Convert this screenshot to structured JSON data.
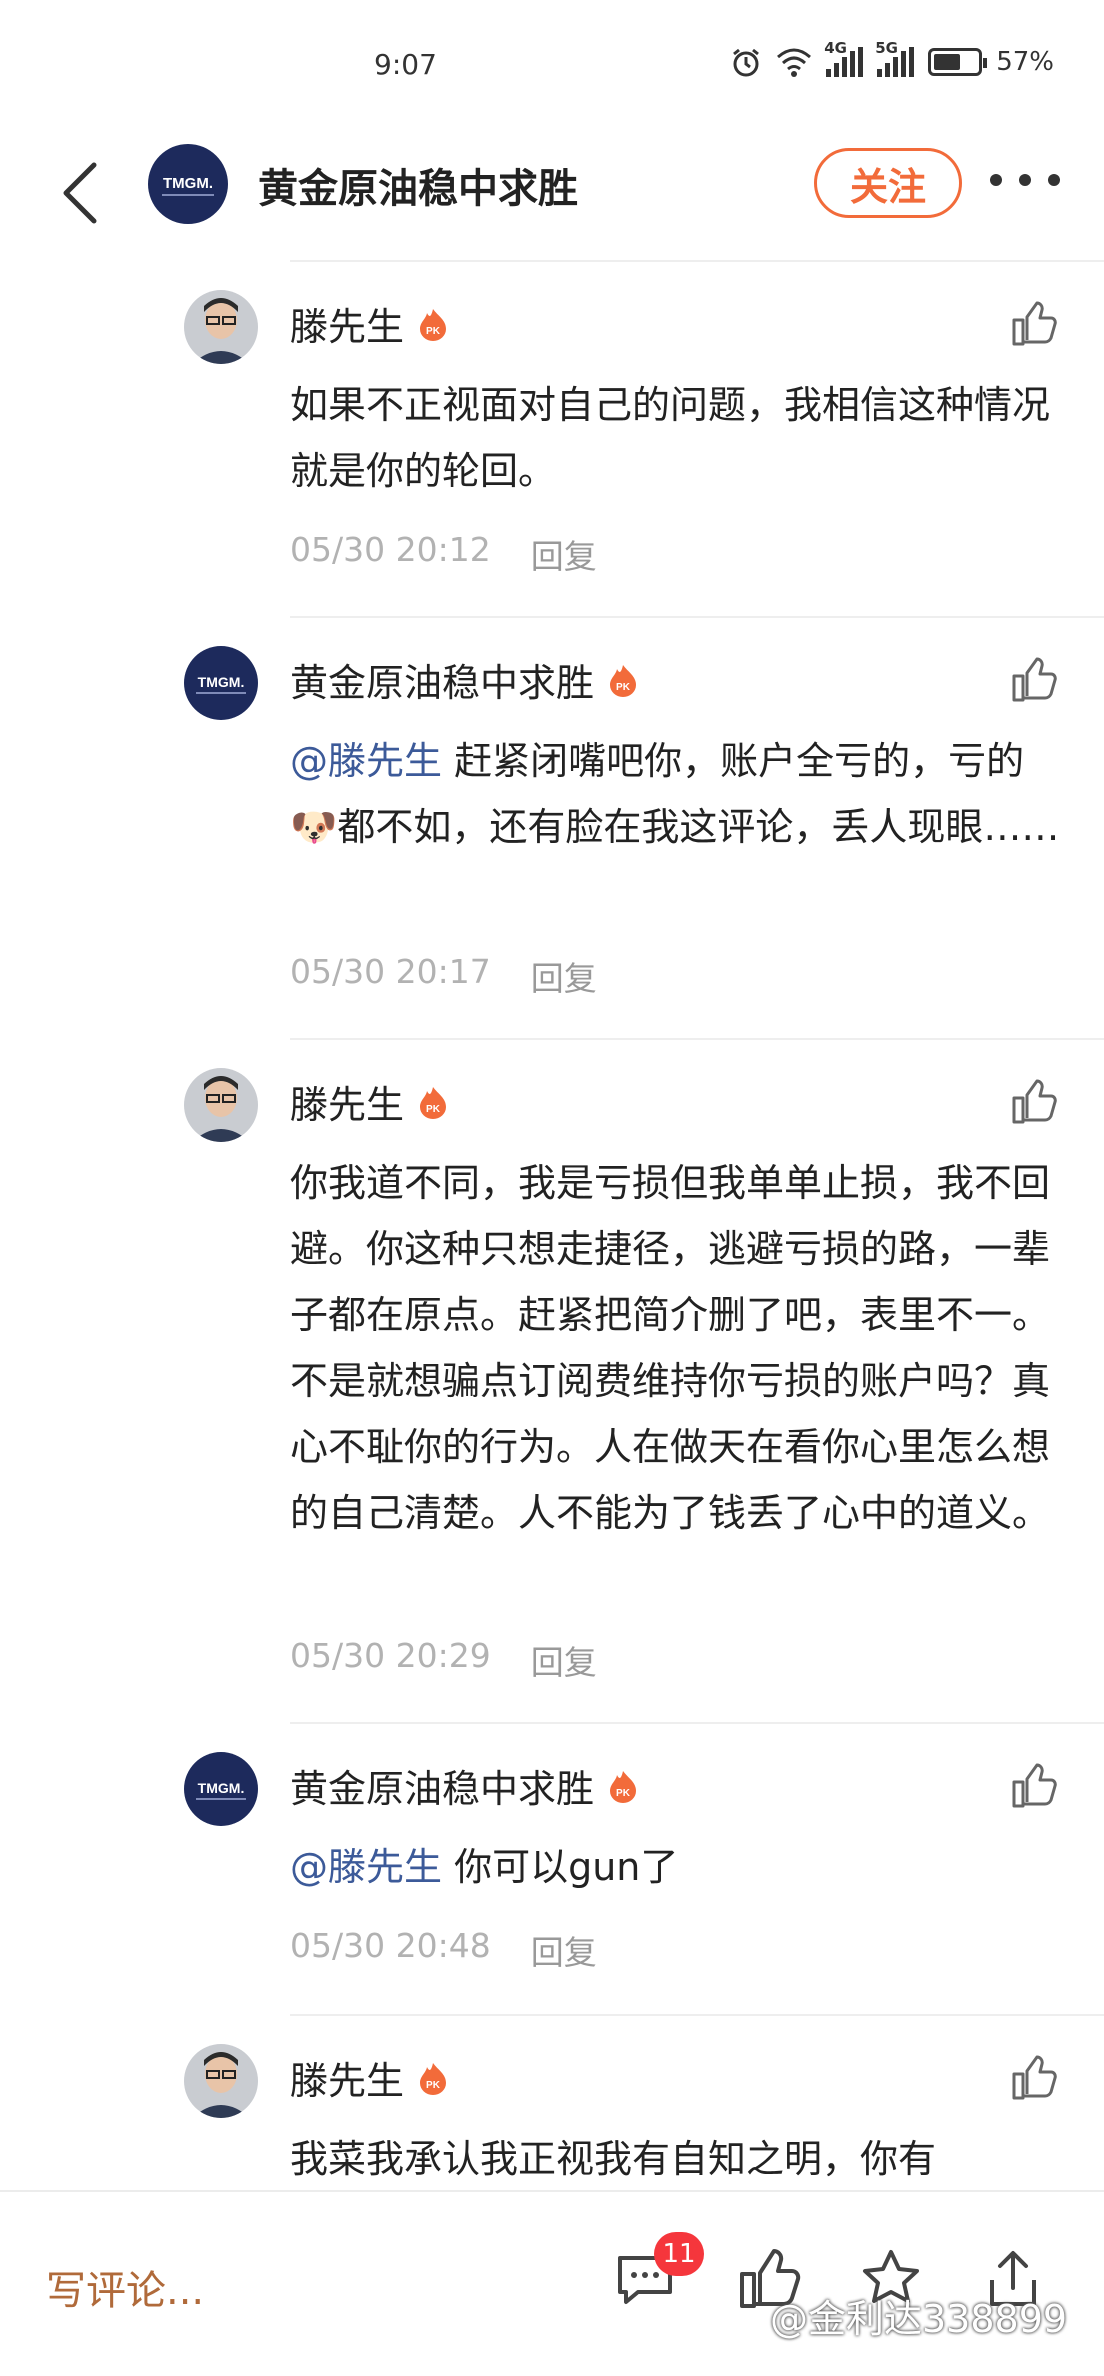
{
  "status_bar": {
    "time": "9:07",
    "network_4g": "4G",
    "network_5g": "5G",
    "battery": "57%"
  },
  "header": {
    "title": "黄金原油稳中求胜",
    "follow_label": "关注",
    "logo_text": "TMGM."
  },
  "comments": [
    {
      "user": "滕先生",
      "text": "如果不正视面对自己的问题，我相信这种情况就是你的轮回。",
      "mention": "",
      "time": "05/30 20:12",
      "reply": "回复"
    },
    {
      "user": "黄金原油稳中求胜",
      "mention": "@滕先生",
      "text": " 赶紧闭嘴吧你，账户全亏的，亏的🐶都不如，还有脸在我这评论，丢人现眼……",
      "time": "05/30 20:17",
      "reply": "回复"
    },
    {
      "user": "滕先生",
      "text": "你我道不同，我是亏损但我单单止损，我不回避。你这种只想走捷径，逃避亏损的路，一辈子都在原点。赶紧把简介删了吧，表里不一。不是就想骗点订阅费维持你亏损的账户吗？真心不耻你的行为。人在做天在看你心里怎么想的自己清楚。人不能为了钱丢了心中的道义。",
      "mention": "",
      "time": "05/30 20:29",
      "reply": "回复"
    },
    {
      "user": "黄金原油稳中求胜",
      "mention": "@滕先生",
      "text": " 你可以gun了",
      "time": "05/30 20:48",
      "reply": "回复"
    },
    {
      "user": "滕先生",
      "text": "我菜我承认我正视我有自知之明，你有",
      "mention": "",
      "time": "",
      "reply": ""
    }
  ],
  "bottom_bar": {
    "write_comment": "写评论...",
    "comment_count": "11",
    "watermark": "@金利达338899"
  },
  "colors": {
    "accent": "#f26b3a",
    "mention": "#3c5a99",
    "meta": "#b2b2b2",
    "badge": "#f5363c"
  }
}
